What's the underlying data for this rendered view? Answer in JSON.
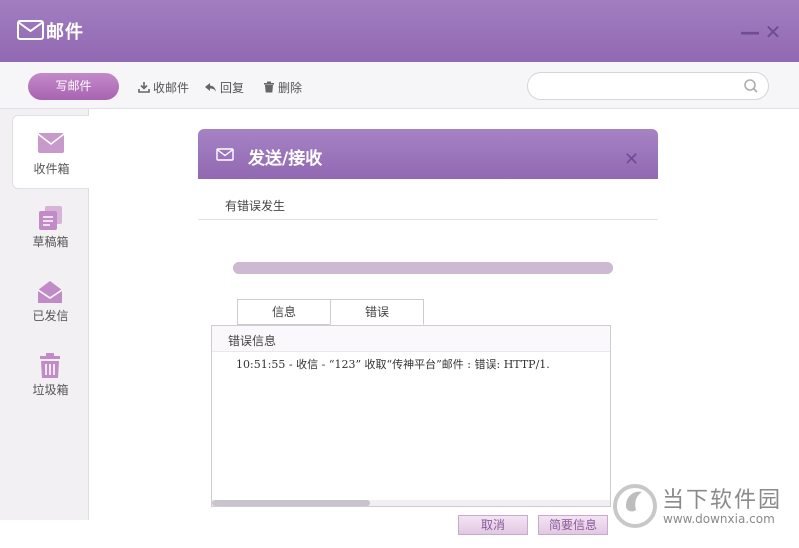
{
  "window": {
    "title": "邮件",
    "minimize": "—",
    "close": "✕"
  },
  "toolbar": {
    "compose_label": "写邮件",
    "receive_label": "收邮件",
    "reply_label": "回复",
    "delete_label": "删除",
    "search_placeholder": ""
  },
  "sidebar": {
    "items": [
      {
        "label": "收件箱",
        "icon": "envelope-icon",
        "active": true
      },
      {
        "label": "草稿箱",
        "icon": "drafts-icon",
        "active": false
      },
      {
        "label": "已发信",
        "icon": "sent-icon",
        "active": false
      },
      {
        "label": "垃圾箱",
        "icon": "trash-icon",
        "active": false
      }
    ]
  },
  "dialog": {
    "title": "发送/接收",
    "close": "✕",
    "status": "有错误发生",
    "progress": 1.0,
    "tabs": [
      {
        "label": "信息"
      },
      {
        "label": "错误"
      }
    ],
    "panel_header": "错误信息",
    "log": [
      "10:51:55 - 收信 - “123” 收取“传神平台”邮件 : 错误: HTTP/1."
    ],
    "buttons": {
      "cancel": "取消",
      "brief": "简要信息"
    }
  },
  "watermark": {
    "name": "当下软件园",
    "url": "www.downxia.com"
  },
  "colors": {
    "accent": "#9a73b9",
    "button": "#b272bc",
    "progress": "#cdb9d2"
  }
}
